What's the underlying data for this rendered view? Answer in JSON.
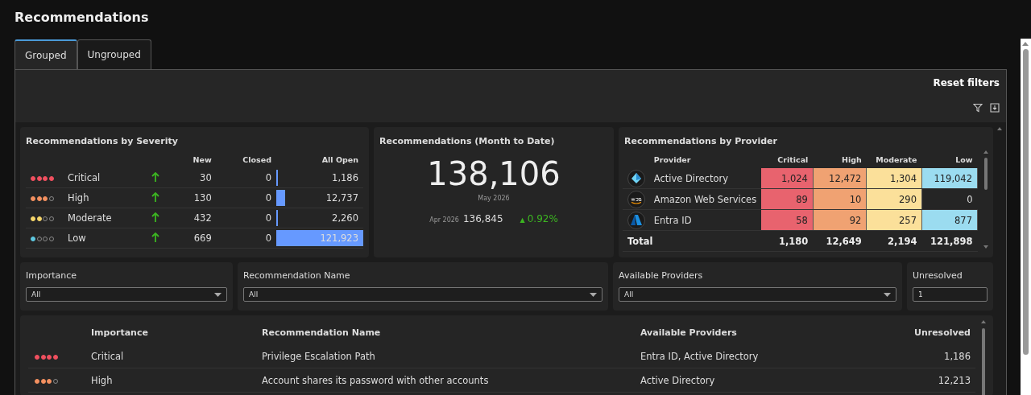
{
  "page": {
    "title": "Recommendations"
  },
  "tabs": [
    {
      "label": "Grouped",
      "selected": true
    },
    {
      "label": "Ungrouped",
      "selected": false
    }
  ],
  "toolbar": {
    "reset_label": "Reset filters"
  },
  "severity_card": {
    "title": "Recommendations by Severity",
    "columns": [
      "New",
      "Closed",
      "All Open"
    ],
    "rows": [
      {
        "stars": 4,
        "color": "#f0505f",
        "label": "Critical",
        "kind": "rising",
        "new": "30",
        "closed": "0",
        "all_open": "1,186",
        "level": 0.0097
      },
      {
        "stars": 3,
        "color": "#f39060",
        "label": "High",
        "kind": "rising",
        "new": "130",
        "closed": "0",
        "all_open": "12,737",
        "level": 0.104
      },
      {
        "stars": 2,
        "color": "#f5d56a",
        "label": "Moderate",
        "kind": "rising",
        "new": "432",
        "closed": "0",
        "all_open": "2,260",
        "level": 0.0185
      },
      {
        "stars": 1,
        "color": "#5ec8e0",
        "label": "Low",
        "kind": "rising",
        "new": "669",
        "closed": "0",
        "all_open": "121,923",
        "level": 1.0
      }
    ]
  },
  "month_card": {
    "title": "Recommendations (Month to Date)",
    "value": "138,106",
    "period": "May 2026",
    "prev_period": "Apr 2026",
    "prev_value": "136,845",
    "change_icon": "▲",
    "change": "0.92%"
  },
  "provider_card": {
    "title": "Recommendations by Provider",
    "provider_column": "Provider",
    "level_columns": [
      "Critical",
      "High",
      "Moderate",
      "Low"
    ],
    "rows": [
      {
        "kind": "pyramid",
        "name": "Active Directory",
        "cells": [
          {
            "value": "1,024",
            "color": "#e8636e"
          },
          {
            "value": "12,472",
            "color": "#f0a272"
          },
          {
            "value": "1,304",
            "color": "#fbe09a"
          },
          {
            "value": "119,042",
            "color": "#9bdcf0"
          }
        ]
      },
      {
        "kind": "aws",
        "name": "Amazon Web Services",
        "cells": [
          {
            "value": "89",
            "color": "#e8636e"
          },
          {
            "value": "10",
            "color": "#f0a272"
          },
          {
            "value": "290",
            "color": "#fbe09a"
          },
          {
            "value": "0"
          }
        ]
      },
      {
        "kind": "azure",
        "name": "Entra ID",
        "cells": [
          {
            "value": "58",
            "color": "#e8636e"
          },
          {
            "value": "92",
            "color": "#f0a272"
          },
          {
            "value": "257",
            "color": "#fbe09a"
          },
          {
            "value": "877",
            "color": "#9bdcf0"
          }
        ]
      }
    ],
    "total_label": "Total",
    "totals": [
      "1,180",
      "12,649",
      "2,194",
      "121,898"
    ]
  },
  "filters": [
    {
      "label": "Importance",
      "kind": "dropdown",
      "value": "All"
    },
    {
      "label": "Recommendation Name",
      "kind": "dropdown",
      "value": "All"
    },
    {
      "label": "Available Providers",
      "kind": "dropdown",
      "value": "All"
    },
    {
      "label": "Unresolved",
      "kind": "text",
      "value": "1"
    }
  ],
  "list": {
    "columns": [
      "Importance",
      "Recommendation Name",
      "Available Providers",
      "Unresolved"
    ],
    "rows": [
      {
        "stars": 4,
        "color": "#f0505f",
        "importance": "Critical",
        "name": "Privilege Escalation Path",
        "providers": "Entra ID, Active Directory",
        "unresolved": "1,186"
      },
      {
        "stars": 3,
        "color": "#f39060",
        "importance": "High",
        "name": "Account shares its password with other accounts",
        "providers": "Active Directory",
        "unresolved": "12,213"
      }
    ]
  }
}
